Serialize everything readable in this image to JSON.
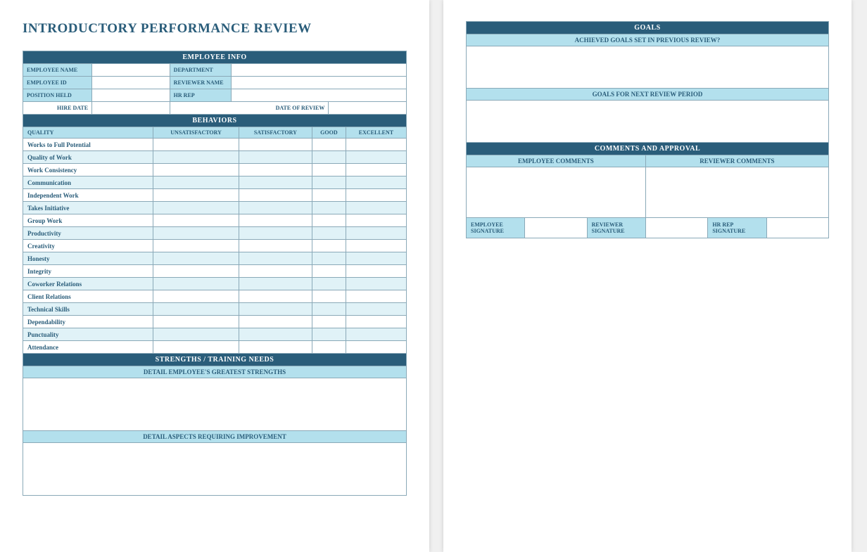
{
  "title": "INTRODUCTORY PERFORMANCE REVIEW",
  "employee_info": {
    "header": "EMPLOYEE INFO",
    "fields": {
      "employee_name": "EMPLOYEE NAME",
      "department": "DEPARTMENT",
      "employee_id": "EMPLOYEE ID",
      "reviewer_name": "REVIEWER NAME",
      "position_held": "POSITION HELD",
      "hr_rep": "HR REP",
      "hire_date": "HIRE DATE",
      "date_of_review": "DATE OF REVIEW"
    }
  },
  "behaviors": {
    "header": "BEHAVIORS",
    "quality_label": "QUALITY",
    "ratings": [
      "UNSATISFACTORY",
      "SATISFACTORY",
      "GOOD",
      "EXCELLENT"
    ],
    "items": [
      "Works to Full Potential",
      "Quality of Work",
      "Work Consistency",
      "Communication",
      "Independent Work",
      "Takes Initiative",
      "Group Work",
      "Productivity",
      "Creativity",
      "Honesty",
      "Integrity",
      "Coworker Relations",
      "Client Relations",
      "Technical Skills",
      "Dependability",
      "Punctuality",
      "Attendance"
    ]
  },
  "strengths": {
    "header": "STRENGTHS / TRAINING NEEDS",
    "strengths_label": "DETAIL EMPLOYEE'S GREATEST STRENGTHS",
    "improvement_label": "DETAIL ASPECTS REQUIRING IMPROVEMENT"
  },
  "goals": {
    "header": "GOALS",
    "achieved_label": "ACHIEVED GOALS SET IN PREVIOUS REVIEW?",
    "next_label": "GOALS FOR NEXT REVIEW PERIOD"
  },
  "comments": {
    "header": "COMMENTS AND APPROVAL",
    "employee_comments": "EMPLOYEE COMMENTS",
    "reviewer_comments": "REVIEWER COMMENTS",
    "employee_signature": "EMPLOYEE SIGNATURE",
    "reviewer_signature": "REVIEWER SIGNATURE",
    "hr_signature": "HR REP SIGNATURE"
  }
}
